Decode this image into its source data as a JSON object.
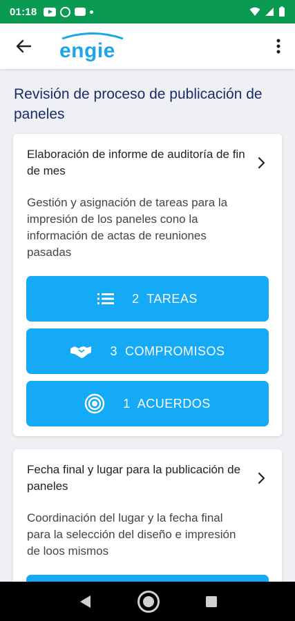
{
  "status_bar": {
    "time": "01:18"
  },
  "app_bar": {
    "logo_text": "engie"
  },
  "page": {
    "title": "Revisión de proceso de publicación de paneles"
  },
  "cards": [
    {
      "title": "Elaboración de informe de auditoría de fin de mes",
      "description": "Gestión y asignación de tareas para la impresión de los paneles cono la información de actas de reuniones pasadas",
      "buttons": [
        {
          "label": "2  TAREAS",
          "icon": "list-icon"
        },
        {
          "label": "3  COMPROMISOS",
          "icon": "handshake-icon"
        },
        {
          "label": "1  ACUERDOS",
          "icon": "target-icon"
        }
      ]
    },
    {
      "title": "Fecha final y lugar para la publicación de paneles",
      "description": "Coordinación del lugar y la fecha final para la selección del diseño e impresión de loos mismos"
    }
  ],
  "colors": {
    "status_bar": "#0a9a52",
    "brand": "#1aa6e8",
    "button": "#15aaf6",
    "title": "#1b2c6b"
  }
}
